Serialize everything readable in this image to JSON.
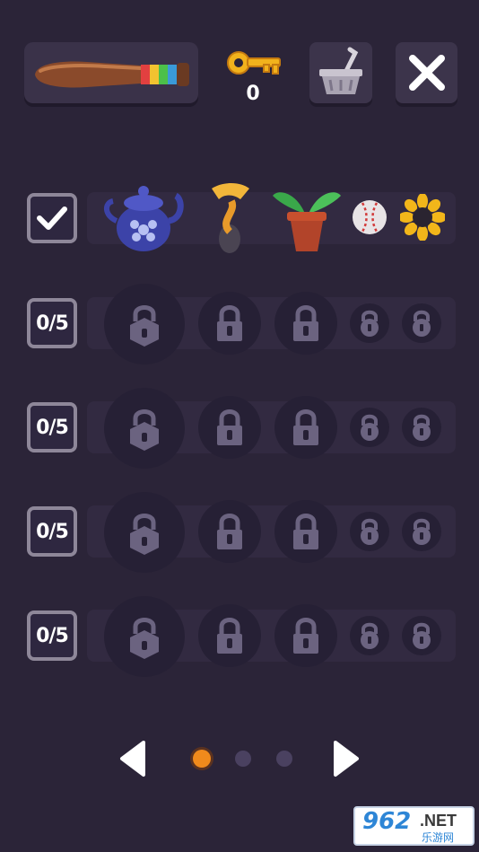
{
  "header": {
    "weapon_icon": "baseball-bat-icon",
    "key_icon": "golden-key-icon",
    "key_count": "0",
    "shop_icon": "shopping-basket-icon",
    "close_icon": "close-x-icon"
  },
  "rows": [
    {
      "status": "complete",
      "status_icon": "checkmark-icon",
      "items": [
        "teapot-icon",
        "horn-icon",
        "potted-plant-icon",
        "baseball-icon",
        "sunflower-icon"
      ]
    },
    {
      "status": "0/5",
      "items": [
        "lock-icon",
        "lock-icon",
        "lock-icon",
        "lock-icon",
        "lock-icon"
      ]
    },
    {
      "status": "0/5",
      "items": [
        "lock-icon",
        "lock-icon",
        "lock-icon",
        "lock-icon",
        "lock-icon"
      ]
    },
    {
      "status": "0/5",
      "items": [
        "lock-icon",
        "lock-icon",
        "lock-icon",
        "lock-icon",
        "lock-icon"
      ]
    },
    {
      "status": "0/5",
      "items": [
        "lock-icon",
        "lock-icon",
        "lock-icon",
        "lock-icon",
        "lock-icon"
      ]
    }
  ],
  "pagination": {
    "current_page": 1,
    "total_pages": 3,
    "prev_icon": "arrow-left-icon",
    "next_icon": "arrow-right-icon",
    "active_color": "#f08a1c",
    "inactive_color": "#4a4160"
  },
  "watermark": {
    "number": "962",
    "domain": ".NET",
    "subtitle": "乐游网"
  },
  "colors": {
    "background": "#2b2438",
    "panel": "#3a3249",
    "row_bar": "#322a41",
    "lock_slot": "#262035",
    "lock_icon": "#6b6380"
  }
}
